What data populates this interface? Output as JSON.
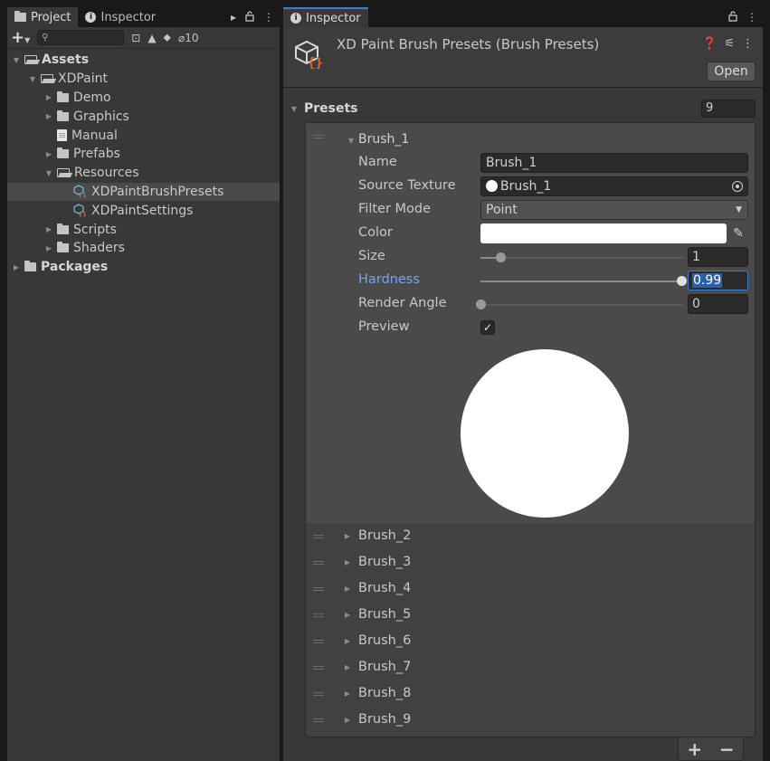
{
  "left_panel": {
    "tabs": [
      {
        "label": "Project",
        "icon": "folder-icon"
      },
      {
        "label": "Inspector",
        "icon": "info-icon"
      }
    ],
    "hidden_count": "10",
    "tree": [
      {
        "label": "Assets",
        "depth": 0,
        "expanded": true,
        "type": "folder-open",
        "bold": true
      },
      {
        "label": "XDPaint",
        "depth": 1,
        "expanded": true,
        "type": "folder-open"
      },
      {
        "label": "Demo",
        "depth": 2,
        "expanded": false,
        "type": "folder"
      },
      {
        "label": "Graphics",
        "depth": 2,
        "expanded": false,
        "type": "folder"
      },
      {
        "label": "Manual",
        "depth": 2,
        "type": "document"
      },
      {
        "label": "Prefabs",
        "depth": 2,
        "expanded": false,
        "type": "folder"
      },
      {
        "label": "Resources",
        "depth": 2,
        "expanded": true,
        "type": "folder-open"
      },
      {
        "label": "XDPaintBrushPresets",
        "depth": 3,
        "type": "preset",
        "selected": true
      },
      {
        "label": "XDPaintSettings",
        "depth": 3,
        "type": "preset"
      },
      {
        "label": "Scripts",
        "depth": 2,
        "expanded": false,
        "type": "folder"
      },
      {
        "label": "Shaders",
        "depth": 2,
        "expanded": false,
        "type": "folder"
      },
      {
        "label": "Packages",
        "depth": 0,
        "expanded": false,
        "type": "folder",
        "bold": true
      }
    ]
  },
  "right_panel": {
    "tab_label": "Inspector",
    "title": "XD Paint Brush Presets (Brush Presets)",
    "open_label": "Open",
    "presets_label": "Presets",
    "presets_count": "9",
    "expanded_brush": {
      "title": "Brush_1",
      "name_label": "Name",
      "name_value": "Brush_1",
      "source_texture_label": "Source Texture",
      "source_texture_value": "Brush_1",
      "filter_mode_label": "Filter Mode",
      "filter_mode_value": "Point",
      "color_label": "Color",
      "color_value": "#ffffff",
      "size_label": "Size",
      "size_value": "1",
      "size_fraction": 0.1,
      "hardness_label": "Hardness",
      "hardness_value": "0.99",
      "hardness_fraction": 0.99,
      "render_angle_label": "Render Angle",
      "render_angle_value": "0",
      "render_angle_fraction": 0.0,
      "preview_label": "Preview",
      "preview_checked": true
    },
    "collapsed_brushes": [
      "Brush_2",
      "Brush_3",
      "Brush_4",
      "Brush_5",
      "Brush_6",
      "Brush_7",
      "Brush_8",
      "Brush_9"
    ]
  },
  "colors": {
    "accent": "#3a7bd5",
    "selection_text": "#7aa4e6",
    "preset_icon_orange": "#e8622c",
    "preset_icon_cube": "#6fb3d9"
  }
}
